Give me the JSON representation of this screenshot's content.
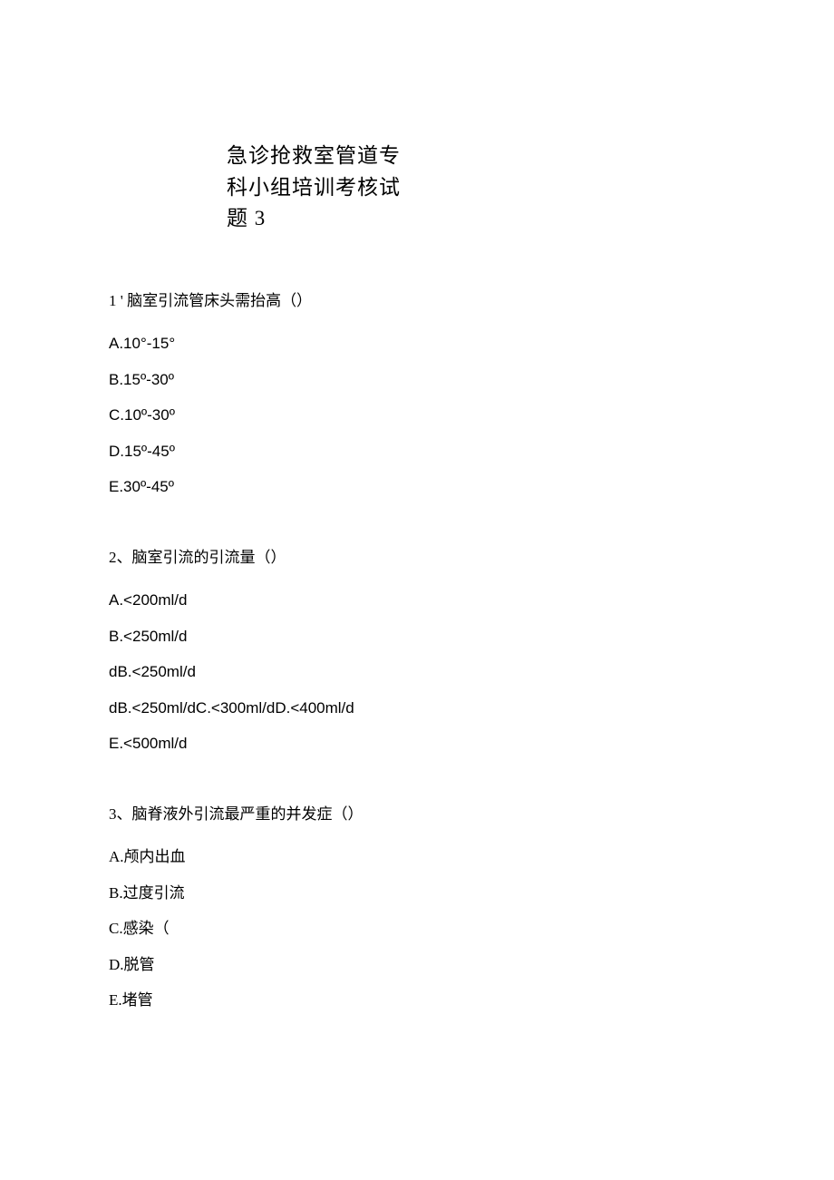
{
  "title": {
    "line1": "急诊抢救室管道专",
    "line2": "科小组培训考核试",
    "line3": "题 3"
  },
  "questions": [
    {
      "stem": "1 ' 脑室引流管床头需抬高（）",
      "options": [
        "A.10°-15°",
        "B.15º-30º",
        "C.10º-30º",
        "D.15º-45º",
        "E.30º-45º"
      ]
    },
    {
      "stem": "2、脑室引流的引流量（）",
      "options": [
        "A.<200ml/d",
        "B.<250ml/d",
        "dB.<250ml/d",
        "dB.<250ml/dC.<300ml/dD.<400ml/d",
        "E.<500ml/d"
      ]
    },
    {
      "stem": "3、脑脊液外引流最严重的并发症（）",
      "options": [
        "A.颅内出血",
        "B.过度引流",
        "C.感染（",
        "D.脱管",
        "E.堵管"
      ]
    }
  ]
}
